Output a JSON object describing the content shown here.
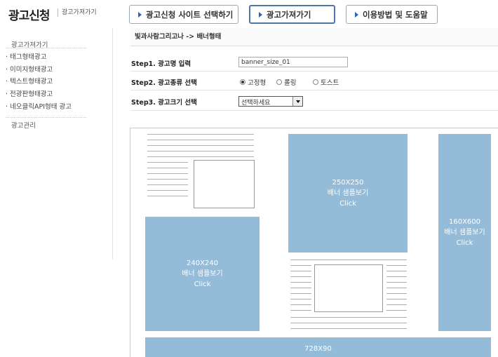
{
  "header": {
    "title": "광고신청",
    "subtitle": "광고가져가기"
  },
  "sidebar": {
    "section1": "광고가져가기",
    "items": [
      "· 태그형태광고",
      "· 이미지형태광고",
      "· 텍스트형태광고",
      "· 전광판형태광고",
      "· 네오클릭API형태 광고"
    ],
    "section2": "광고관리"
  },
  "top_buttons": [
    {
      "label": "광고신청 사이트 선택하기"
    },
    {
      "label": "광고가져가기"
    },
    {
      "label": "이용방법 및 도움말"
    }
  ],
  "breadcrumb": "빛과사람그리고나 -> 배너형태",
  "steps": {
    "step1_label": "Step1. 광고명 입력",
    "step1_value": "banner_size_01",
    "step2_label": "Step2. 광고종류 선택",
    "step2_options": [
      {
        "label": "고정형",
        "checked": true
      },
      {
        "label": "롤링",
        "checked": false
      },
      {
        "label": "토스트",
        "checked": false
      }
    ],
    "step3_label": "Step3. 광고크기 선택",
    "step3_value": "선택하세요"
  },
  "banners": {
    "b250": {
      "size": "250X250",
      "label": "배너 샘플보기",
      "action": "Click"
    },
    "b160": {
      "size": "160X600",
      "label": "배너 샘플보기",
      "action": "Click"
    },
    "b240": {
      "size": "240X240",
      "label": "배너 샘플보기",
      "action": "Click"
    },
    "b728": {
      "size": "728X90"
    }
  },
  "colors": {
    "banner": "#94bbd7",
    "active_border": "#4d77a8",
    "icon": "#2b67b5"
  }
}
